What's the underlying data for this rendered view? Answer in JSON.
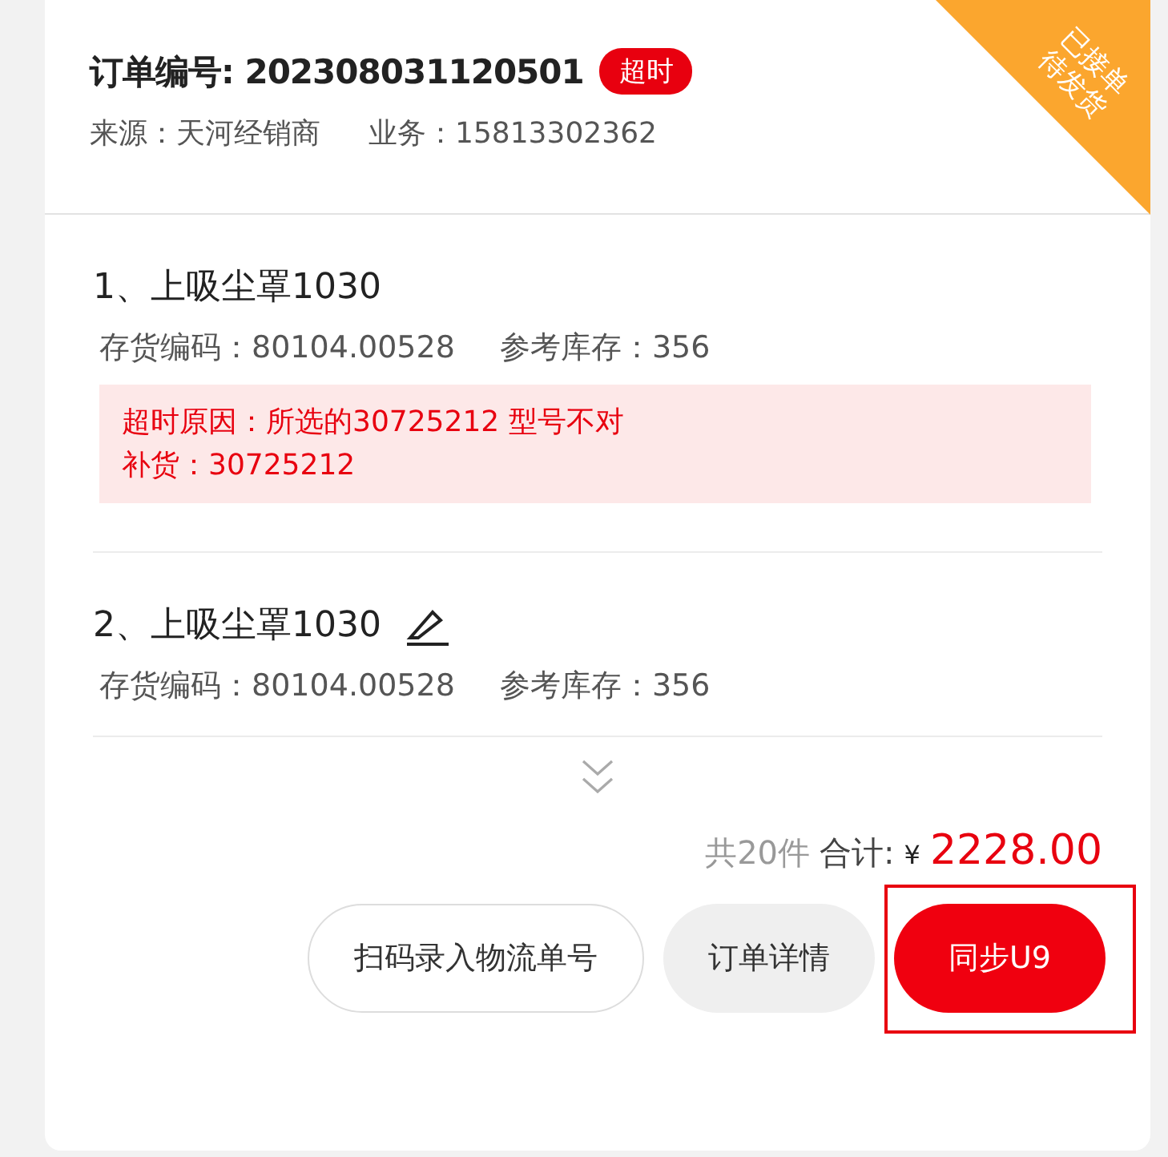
{
  "order": {
    "title": "订单编号: 202308031120501",
    "badge": "超时",
    "source": "来源：天河经销商",
    "business": "业务：15813302362",
    "ribbon": [
      "已接单",
      "待发货"
    ]
  },
  "items": [
    {
      "name": "1、上吸尘罩1030",
      "editable": false,
      "code": "存货编码：80104.00528",
      "stock": "参考库存：356",
      "warning": [
        "超时原因：所选的30725212 型号不对",
        "补货：30725212"
      ]
    },
    {
      "name": "2、上吸尘罩1030",
      "editable": true,
      "code": "存货编码：80104.00528",
      "stock": "参考库存：356"
    }
  ],
  "summary": {
    "count": "共20件",
    "total_label": "合计:",
    "currency": "¥",
    "total": "2228.00"
  },
  "buttons": [
    {
      "label": "扫码录入物流单号",
      "kind": "outline",
      "highlighted": false
    },
    {
      "label": "订单详情",
      "kind": "gray",
      "highlighted": false
    },
    {
      "label": "同步U9",
      "kind": "primary",
      "highlighted": true
    }
  ]
}
